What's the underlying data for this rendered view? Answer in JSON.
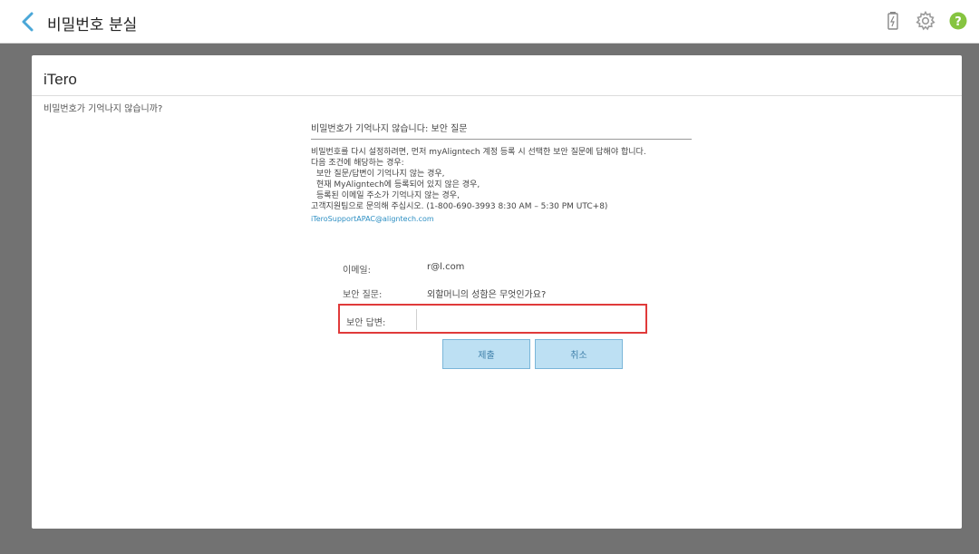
{
  "header": {
    "title": "비밀번호 분실",
    "icons": [
      "back-chevron-icon",
      "battery-icon",
      "gear-icon",
      "help-icon"
    ],
    "accent": "#4aa7d8",
    "help_color": "#86c440"
  },
  "brand": "iTero",
  "page_heading": "비밀번호가 기억나지 않습니까?",
  "panel": {
    "heading": "비밀번호가 기억나지 않습니다: 보안 질문",
    "lines": [
      "비밀번호를 다시 설정하려면, 먼저 myAligntech 계정 등록 시 선택한 보안 질문에 답해야 합니다.",
      "다음 조건에 해당하는 경우:",
      "보안 질문/답변이 기억나지 않는 경우,",
      "현재 MyAligntech에 등록되어 있지 않은 경우,",
      "등록된 이메일 주소가 기억나지 않는 경우,",
      "고객지원팀으로 문의해 주십시오. (1-800-690-3993 8:30 AM – 5:30 PM UTC+8)"
    ],
    "support_email": "iTeroSupportAPAC@aligntech.com"
  },
  "form": {
    "email_label": "이메일:",
    "email_value": "r@l.com",
    "question_label": "보안 질문:",
    "question_value": "외할머니의 성함은 무엇인가요?",
    "answer_label": "보안 답변:",
    "answer_value": "",
    "highlight_color": "#e03a3a"
  },
  "buttons": {
    "submit": "제출",
    "cancel": "취소",
    "fill": "#bde0f3"
  }
}
